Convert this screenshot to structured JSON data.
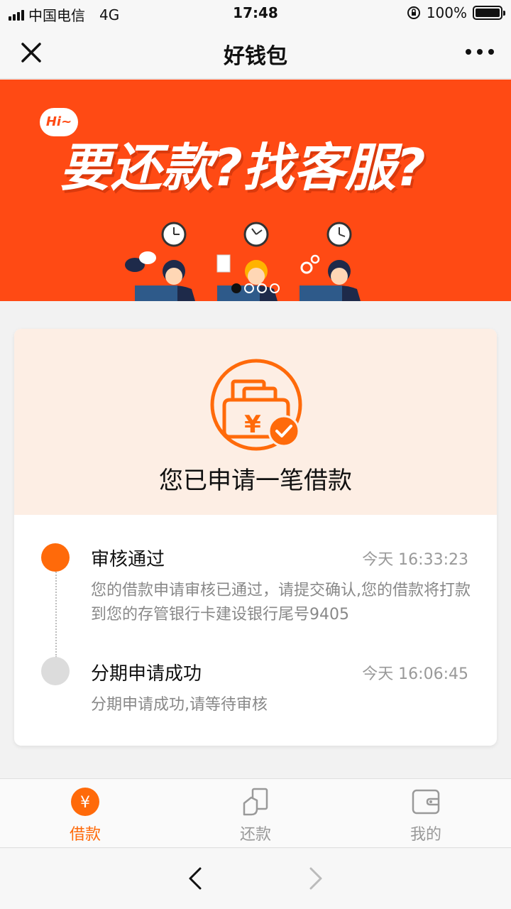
{
  "status_bar": {
    "carrier": "中国电信",
    "network": "4G",
    "time": "17:48",
    "battery": "100%",
    "battery_level": 1.0
  },
  "nav": {
    "title": "好钱包",
    "close_icon": "close-icon",
    "more_icon": "more-icon"
  },
  "banner": {
    "hi": "Hi~",
    "headline": "要还款?找客服?",
    "color": "#ff4a14",
    "carousel_total": 4,
    "carousel_active": 1
  },
  "card": {
    "title": "您已申请一笔借款",
    "icon": "wallet-check-icon",
    "accent": "#ff6a0a"
  },
  "timeline": [
    {
      "title": "审核通过",
      "time": "今天 16:33:23",
      "desc": "您的借款申请审核已通过，请提交确认,您的借款将打款到您的存管银行卡建设银行尾号9405",
      "status": "active"
    },
    {
      "title": "分期申请成功",
      "time": "今天 16:06:45",
      "desc": "分期申请成功,请等待审核",
      "status": "inactive"
    }
  ],
  "tabs": [
    {
      "label": "借款",
      "icon": "yen-icon",
      "active": true
    },
    {
      "label": "还款",
      "icon": "repay-icon",
      "active": false
    },
    {
      "label": "我的",
      "icon": "wallet-icon",
      "active": false
    }
  ],
  "browser": {
    "back_icon": "chevron-left-icon",
    "forward_icon": "chevron-right-icon"
  }
}
